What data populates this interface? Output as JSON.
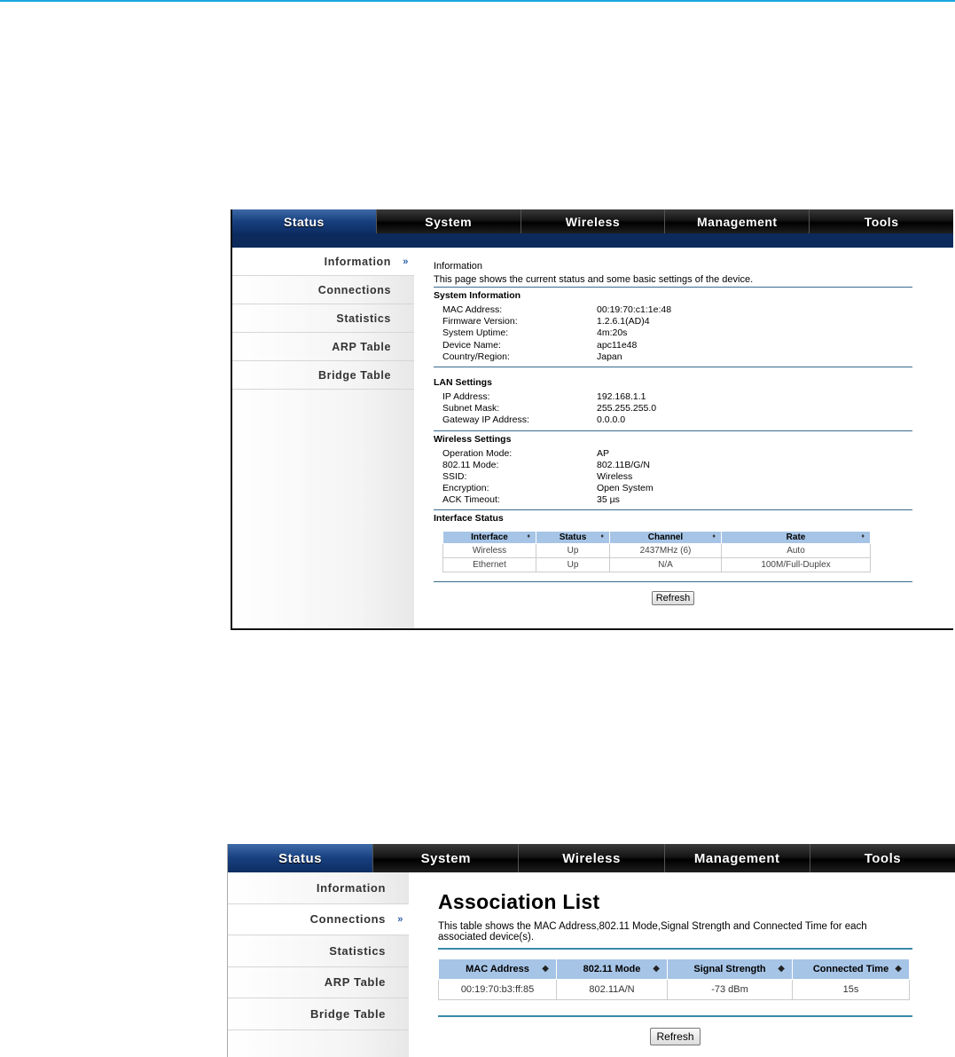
{
  "nav": {
    "tabs": [
      "Status",
      "System",
      "Wireless",
      "Management",
      "Tools"
    ]
  },
  "sidebar": {
    "items": [
      "Information",
      "Connections",
      "Statistics",
      "ARP Table",
      "Bridge Table"
    ],
    "arrow": "»"
  },
  "info": {
    "title": "Information",
    "description": "This page shows the current status and some basic settings of the device.",
    "system": {
      "heading": "System Information",
      "rows": [
        {
          "k": "MAC Address:",
          "v": "00:19:70:c1:1e:48"
        },
        {
          "k": "Firmware Version:",
          "v": "1.2.6.1(AD)4"
        },
        {
          "k": "System Uptime:",
          "v": "4m:20s"
        },
        {
          "k": "Device Name:",
          "v": "apc11e48"
        },
        {
          "k": "Country/Region:",
          "v": "Japan"
        }
      ]
    },
    "lan": {
      "heading": "LAN Settings",
      "rows": [
        {
          "k": "IP Address:",
          "v": "192.168.1.1"
        },
        {
          "k": "Subnet Mask:",
          "v": "255.255.255.0"
        },
        {
          "k": "Gateway IP Address:",
          "v": "0.0.0.0"
        }
      ]
    },
    "wireless": {
      "heading": "Wireless Settings",
      "rows": [
        {
          "k": "Operation Mode:",
          "v": "AP"
        },
        {
          "k": "802.11 Mode:",
          "v": "802.11B/G/N"
        },
        {
          "k": "SSID:",
          "v": "Wireless"
        },
        {
          "k": "Encryption:",
          "v": "Open System"
        },
        {
          "k": "ACK Timeout:",
          "v": "35 µs"
        }
      ]
    },
    "interface": {
      "heading": "Interface Status",
      "columns": [
        "Interface",
        "Status",
        "Channel",
        "Rate"
      ],
      "rows": [
        [
          "Wireless",
          "Up",
          "2437MHz (6)",
          "Auto"
        ],
        [
          "Ethernet",
          "Up",
          "N/A",
          "100M/Full-Duplex"
        ]
      ]
    },
    "refresh_label": "Refresh"
  },
  "assoc": {
    "title": "Association List",
    "description": "This table shows the MAC Address,802.11 Mode,Signal Strength and Connected Time for each associated device(s).",
    "columns": [
      "MAC Address",
      "802.11 Mode",
      "Signal Strength",
      "Connected Time"
    ],
    "rows": [
      [
        "00:19:70:b3:ff:85",
        "802.11A/N",
        "-73 dBm",
        "15s"
      ]
    ],
    "refresh_label": "Refresh"
  },
  "icons": {
    "sort": "sort-icon",
    "arrow": "double-chevron-right-icon"
  },
  "colors": {
    "accent": "#173f7e",
    "table_header": "#a6c4e6",
    "topline": "#1aa7e0"
  }
}
